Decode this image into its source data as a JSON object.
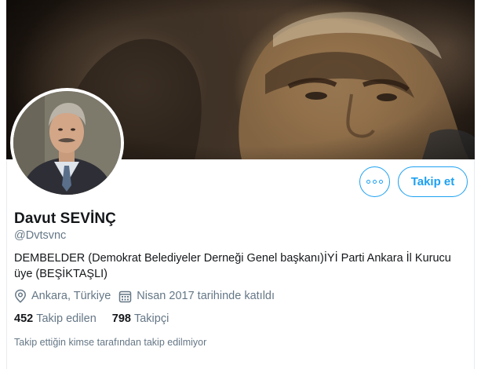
{
  "profile": {
    "name": "Davut SEVİNÇ",
    "handle": "@Dvtsvnc",
    "bio": "DEMBELDER (Demokrat Belediyeler Derneği Genel başkanı)İYİ Parti Ankara İl Kurucu üye (BEŞİKTAŞLI)",
    "location": "Ankara, Türkiye",
    "joined": "Nisan 2017 tarihinde katıldı",
    "following_count": "452",
    "following_label": "Takip edilen",
    "followers_count": "798",
    "followers_label": "Takipçi",
    "followed_by_note": "Takip ettiğin kimse tarafından takip edilmiyor"
  },
  "actions": {
    "follow_label": "Takip et",
    "more_icon": "more-icon"
  },
  "icons": {
    "location": "location-pin-icon",
    "joined": "calendar-icon"
  },
  "colors": {
    "accent": "#1da1f2",
    "secondary_text": "#657786",
    "primary_text": "#14171a"
  }
}
